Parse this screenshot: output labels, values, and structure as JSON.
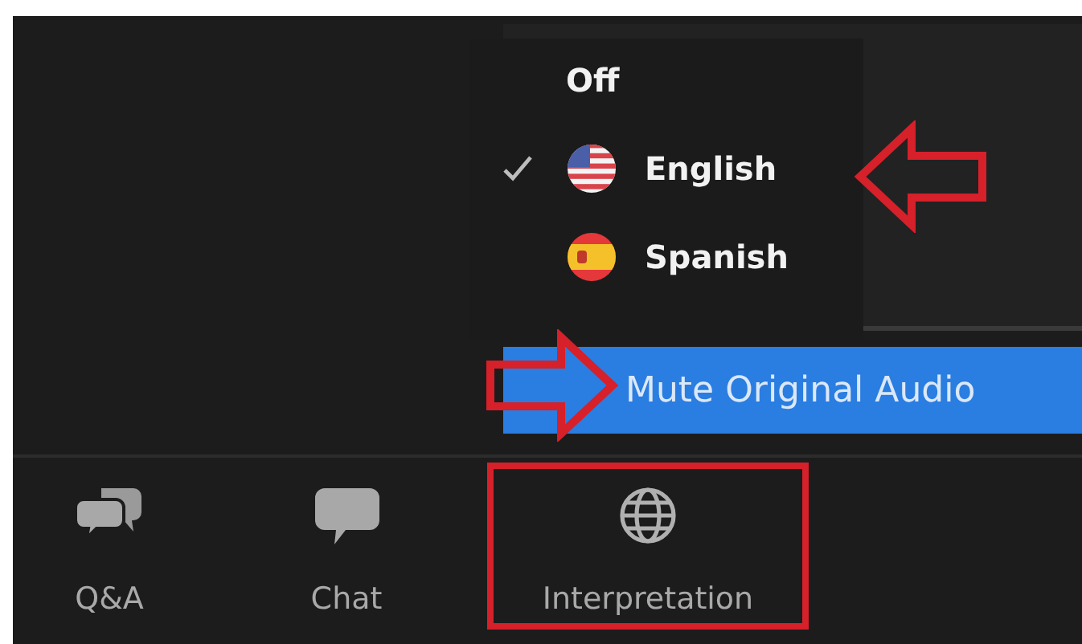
{
  "language_menu": {
    "items": [
      {
        "label": "Off",
        "kind": "plain",
        "checked": false
      },
      {
        "label": "English",
        "kind": "us-flag",
        "checked": true
      },
      {
        "label": "Spanish",
        "kind": "es-flag",
        "checked": false
      }
    ]
  },
  "mute_original_audio": {
    "label": "Mute Original Audio"
  },
  "toolbar": [
    {
      "label": "Q&A",
      "kind": "qa",
      "highlighted": false
    },
    {
      "label": "Chat",
      "kind": "chat",
      "highlighted": false
    },
    {
      "label": "Interpretation",
      "kind": "globe",
      "highlighted": true
    }
  ],
  "annotations": [
    {
      "kind": "arrow-left"
    },
    {
      "kind": "arrow-right"
    }
  ]
}
